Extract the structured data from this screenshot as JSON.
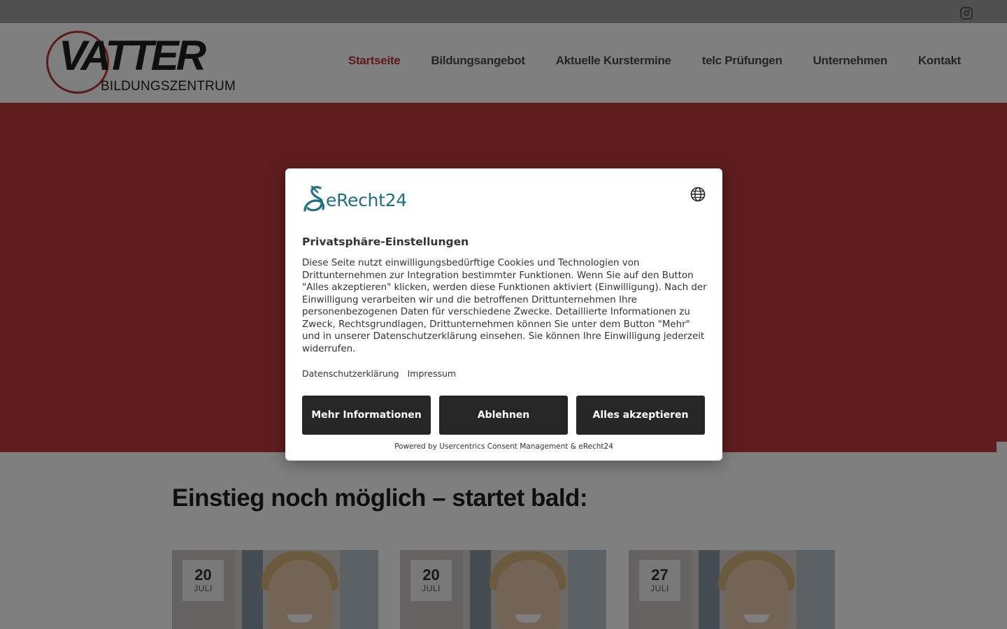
{
  "site": {
    "logo": {
      "word": "VATTER",
      "subtitle": "BILDUNGSZENTRUM"
    },
    "nav": {
      "items": [
        {
          "label": "Startseite",
          "active": true
        },
        {
          "label": "Bildungsangebot",
          "active": false
        },
        {
          "label": "Aktuelle Kurstermine",
          "active": false
        },
        {
          "label": "telc Prüfungen",
          "active": false
        },
        {
          "label": "Unternehmen",
          "active": false
        },
        {
          "label": "Kontakt",
          "active": false
        }
      ]
    },
    "topbar": {
      "icons": [
        "instagram-icon"
      ]
    },
    "section_title": "Einstieg noch möglich – startet bald:",
    "cards": [
      {
        "day": "20",
        "month": "JULI"
      },
      {
        "day": "20",
        "month": "JULI"
      },
      {
        "day": "27",
        "month": "JULI"
      }
    ],
    "colors": {
      "brand_red": "#c13b3d",
      "nav_active": "#c0333a",
      "nav_text": "#4b4b4b"
    }
  },
  "consent": {
    "brand": "eRecht24",
    "title": "Privatsphäre-Einstellungen",
    "body": "Diese Seite nutzt einwilligungsbedürftige Cookies und Technologien von Drittunternehmen zur Integration bestimmter Funktionen. Wenn Sie auf den Button \"Alles akzeptieren\" klicken, werden diese Funktionen aktiviert (Einwilligung). Nach der Einwilligung verarbeiten wir und die betroffenen Drittunternehmen Ihre personenbezogenen Daten für verschiedene Zwecke. Detaillierte Informationen zu Zweck, Rechtsgrundlagen, Drittunternehmen können Sie unter dem Button \"Mehr\" und in unserer Datenschutzerklärung einsehen. Sie können Ihre Einwilligung jederzeit widerrufen.",
    "links": {
      "privacy": "Datenschutzerklärung",
      "imprint": "Impressum"
    },
    "buttons": {
      "more": "Mehr Informationen",
      "deny": "Ablehnen",
      "accept": "Alles akzeptieren"
    },
    "powered_by": "Powered by Usercentrics Consent Management & eRecht24",
    "icons": [
      "globe-icon"
    ],
    "colors": {
      "button_bg": "#262626",
      "brand_teal": "#1f6f86"
    }
  }
}
